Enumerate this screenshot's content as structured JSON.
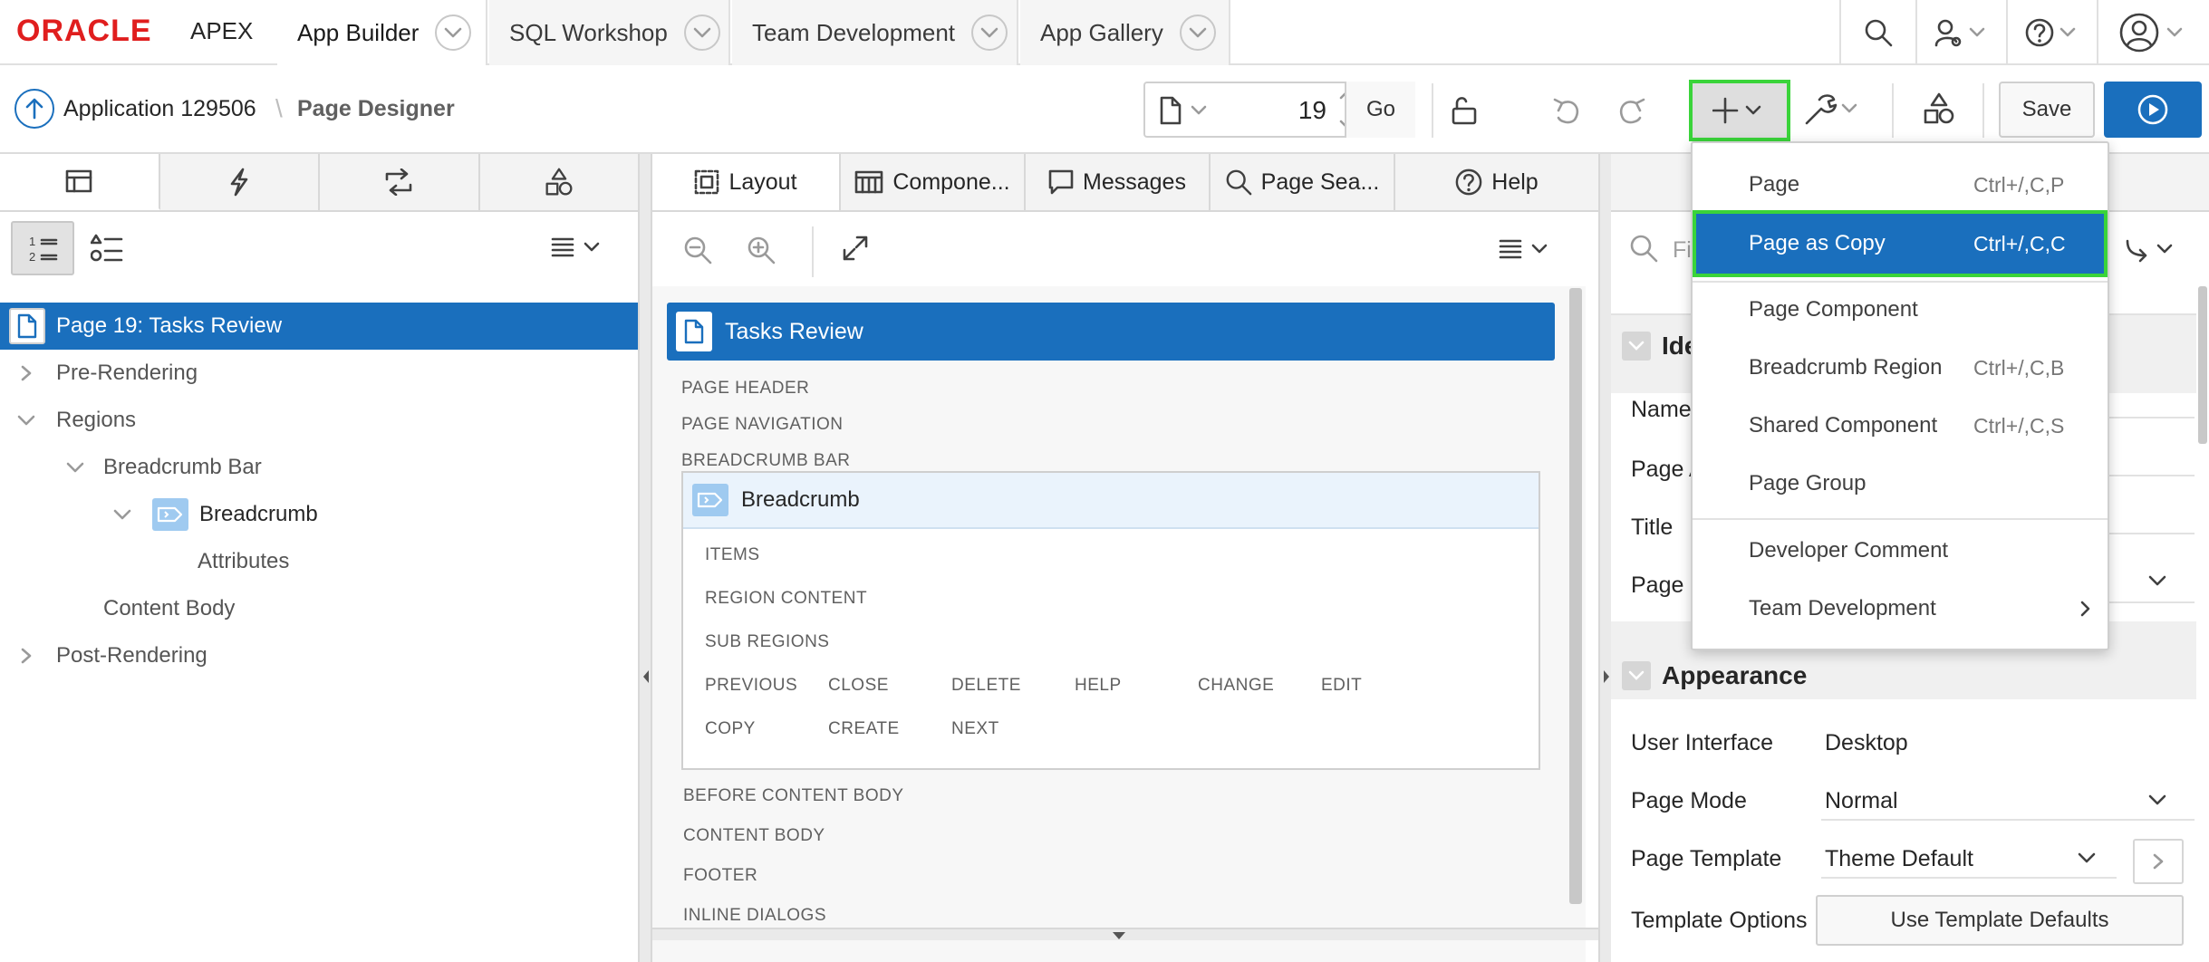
{
  "topnav": {
    "logo_oracle": "ORACLE",
    "logo_apex": "APEX",
    "tabs": [
      {
        "label": "App Builder"
      },
      {
        "label": "SQL Workshop"
      },
      {
        "label": "Team Development"
      },
      {
        "label": "App Gallery"
      }
    ]
  },
  "toolbar": {
    "app_link": "Application 129506",
    "separator": "\\",
    "page_title": "Page Designer",
    "page_number": "19",
    "go_label": "Go",
    "save_label": "Save"
  },
  "left_panel": {
    "tree": {
      "root": "Page 19: Tasks Review",
      "pre_rendering": "Pre-Rendering",
      "regions": "Regions",
      "breadcrumb_bar": "Breadcrumb Bar",
      "breadcrumb": "Breadcrumb",
      "attributes": "Attributes",
      "content_body": "Content Body",
      "post_rendering": "Post-Rendering"
    }
  },
  "center_panel": {
    "tabs": [
      {
        "label": "Layout"
      },
      {
        "label": "Compone..."
      },
      {
        "label": "Messages"
      },
      {
        "label": "Page Sea..."
      },
      {
        "label": "Help"
      }
    ],
    "page_header": "Tasks Review",
    "sections": {
      "page_header": "PAGE HEADER",
      "page_navigation": "PAGE NAVIGATION",
      "breadcrumb_bar": "BREADCRUMB BAR",
      "before_content_body": "BEFORE CONTENT BODY",
      "content_body": "CONTENT BODY",
      "footer": "FOOTER",
      "inline_dialogs": "INLINE DIALOGS"
    },
    "region": {
      "title": "Breadcrumb",
      "items": "ITEMS",
      "region_content": "REGION CONTENT",
      "sub_regions": "SUB REGIONS",
      "buttons_row1": [
        "PREVIOUS",
        "CLOSE",
        "DELETE",
        "HELP",
        "CHANGE",
        "EDIT"
      ],
      "buttons_row2": [
        "COPY",
        "CREATE",
        "NEXT"
      ]
    }
  },
  "right_panel": {
    "filter_placeholder": "Fi",
    "identification_heading": "Ide",
    "fields_partial": {
      "name": "Name",
      "page_alias": "Page Al",
      "title": "Title",
      "page_group": "Page Gr"
    },
    "appearance_heading": "Appearance",
    "appearance": {
      "user_interface_label": "User Interface",
      "user_interface_value": "Desktop",
      "page_mode_label": "Page Mode",
      "page_mode_value": "Normal",
      "page_template_label": "Page Template",
      "page_template_value": "Theme Default",
      "template_options_label": "Template Options",
      "template_options_button": "Use Template Defaults"
    }
  },
  "create_menu": {
    "items": [
      {
        "label": "Page",
        "shortcut": "Ctrl+/,C,P"
      },
      {
        "label": "Page as Copy",
        "shortcut": "Ctrl+/,C,C"
      },
      {
        "label": "Page Component",
        "shortcut": ""
      },
      {
        "label": "Breadcrumb Region",
        "shortcut": "Ctrl+/,C,B"
      },
      {
        "label": "Shared Component",
        "shortcut": "Ctrl+/,C,S"
      },
      {
        "label": "Page Group",
        "shortcut": ""
      },
      {
        "label": "Developer Comment",
        "shortcut": ""
      },
      {
        "label": "Team Development",
        "shortcut": ""
      }
    ],
    "selected_index": 1
  },
  "colors": {
    "selection_blue": "#1a6fbd",
    "highlight_green": "#3ad43a",
    "oracle_red": "#e01e1e"
  }
}
